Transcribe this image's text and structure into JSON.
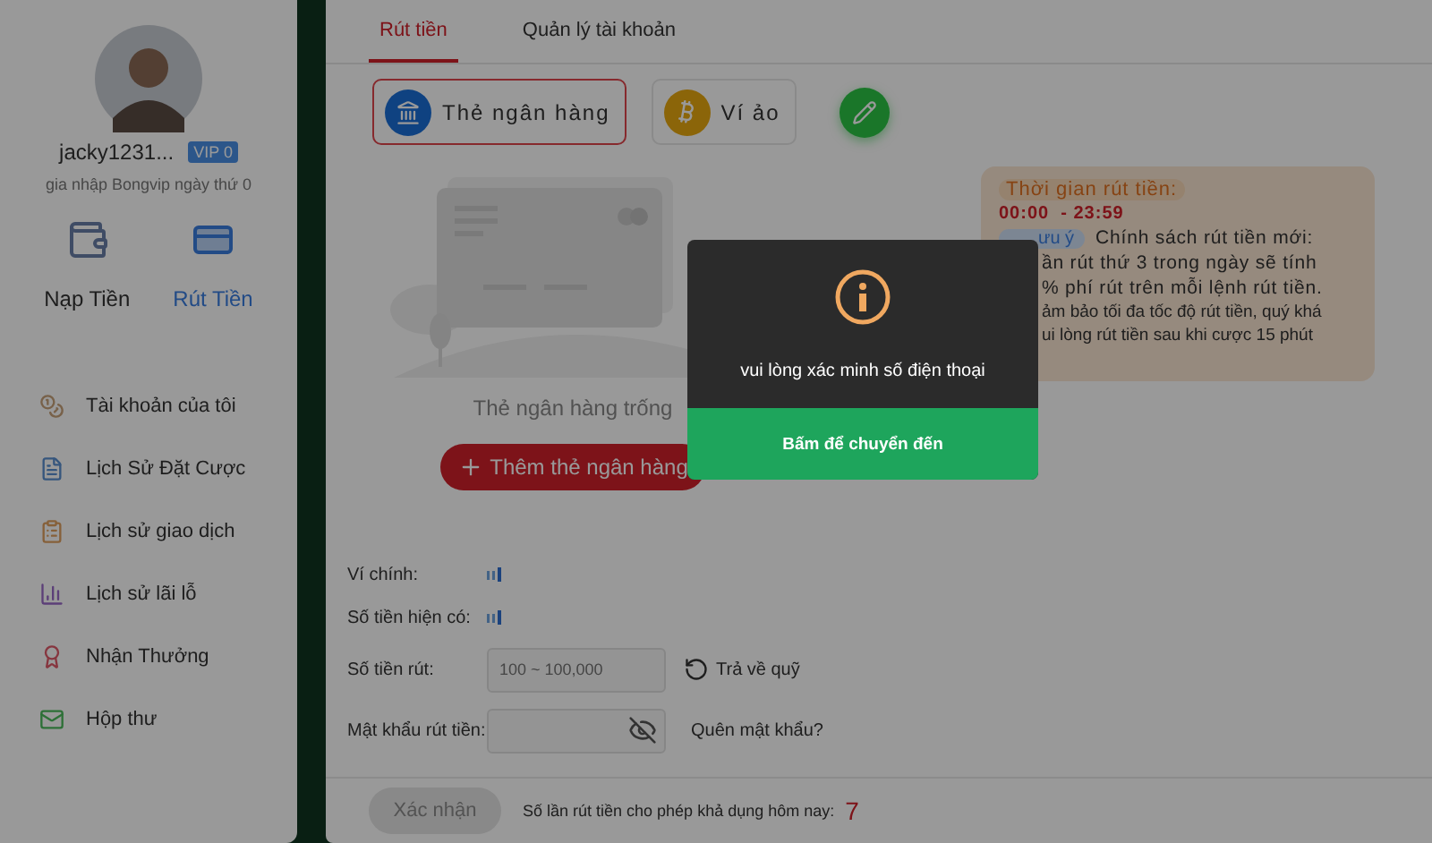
{
  "user": {
    "name": "jacky1231...",
    "vip": "VIP 0",
    "joined": "gia nhập Bongvip ngày thứ 0"
  },
  "quick_actions": [
    {
      "label": "Nạp Tiền",
      "kind": "deposit",
      "selected": false
    },
    {
      "label": "Rút Tiền",
      "kind": "withdraw",
      "selected": true
    }
  ],
  "menu": [
    {
      "label": "Tài khoản của tôi",
      "kind": "account"
    },
    {
      "label": "Lịch Sử Đặt Cược",
      "kind": "bets"
    },
    {
      "label": "Lịch sử giao dịch",
      "kind": "transactions"
    },
    {
      "label": "Lịch sử lãi lỗ",
      "kind": "profit"
    },
    {
      "label": "Nhận Thưởng",
      "kind": "rewards"
    },
    {
      "label": "Hộp thư",
      "kind": "inbox"
    }
  ],
  "tabs": [
    {
      "label": "Rút tiền",
      "selected": true
    },
    {
      "label": "Quản lý tài khoản",
      "selected": false
    }
  ],
  "methods": [
    {
      "label": "Thẻ ngân hàng",
      "kind": "bank",
      "selected": true
    },
    {
      "label": "Ví ảo",
      "kind": "crypto",
      "selected": false
    },
    {
      "kind": "edit",
      "selected": false
    }
  ],
  "empty_card": {
    "text": "Thẻ ngân hàng trống",
    "add_button": "Thêm thẻ ngân hàng"
  },
  "notice": {
    "time_label": "Thời gian rút tiền:",
    "time_range": "00:00  - 23:59",
    "tag": "ưu ý",
    "lines": [
      "Chính sách rút tiền mới:",
      "ần rút thứ 3 trong ngày sẽ tính",
      "% phí rút trên mỗi lệnh rút tiền.",
      "ảm bảo tối đa tốc độ rút tiền, quý khá",
      "ui lòng rút tiền sau khi cược 15 phút"
    ]
  },
  "form": [
    {
      "label": "Ví chính:",
      "kind": "balance"
    },
    {
      "label": "Số tiền hiện có:",
      "kind": "balance"
    },
    {
      "label": "Số tiền rút:",
      "kind": "amount",
      "placeholder": "100 ~ 100,000",
      "action": "Trả về quỹ"
    },
    {
      "label": "Mật khẩu rút tiền:",
      "kind": "password",
      "action": "Quên mật khẩu?"
    }
  ],
  "footer": {
    "confirm": "Xác nhận",
    "disabled": true,
    "limit_label": "Số lần rút tiền cho phép khả dụng hôm nay:",
    "limit_value": "7"
  },
  "modal": {
    "message": "vui lòng xác minh số điện thoại",
    "button": "Bấm để chuyển đến"
  }
}
